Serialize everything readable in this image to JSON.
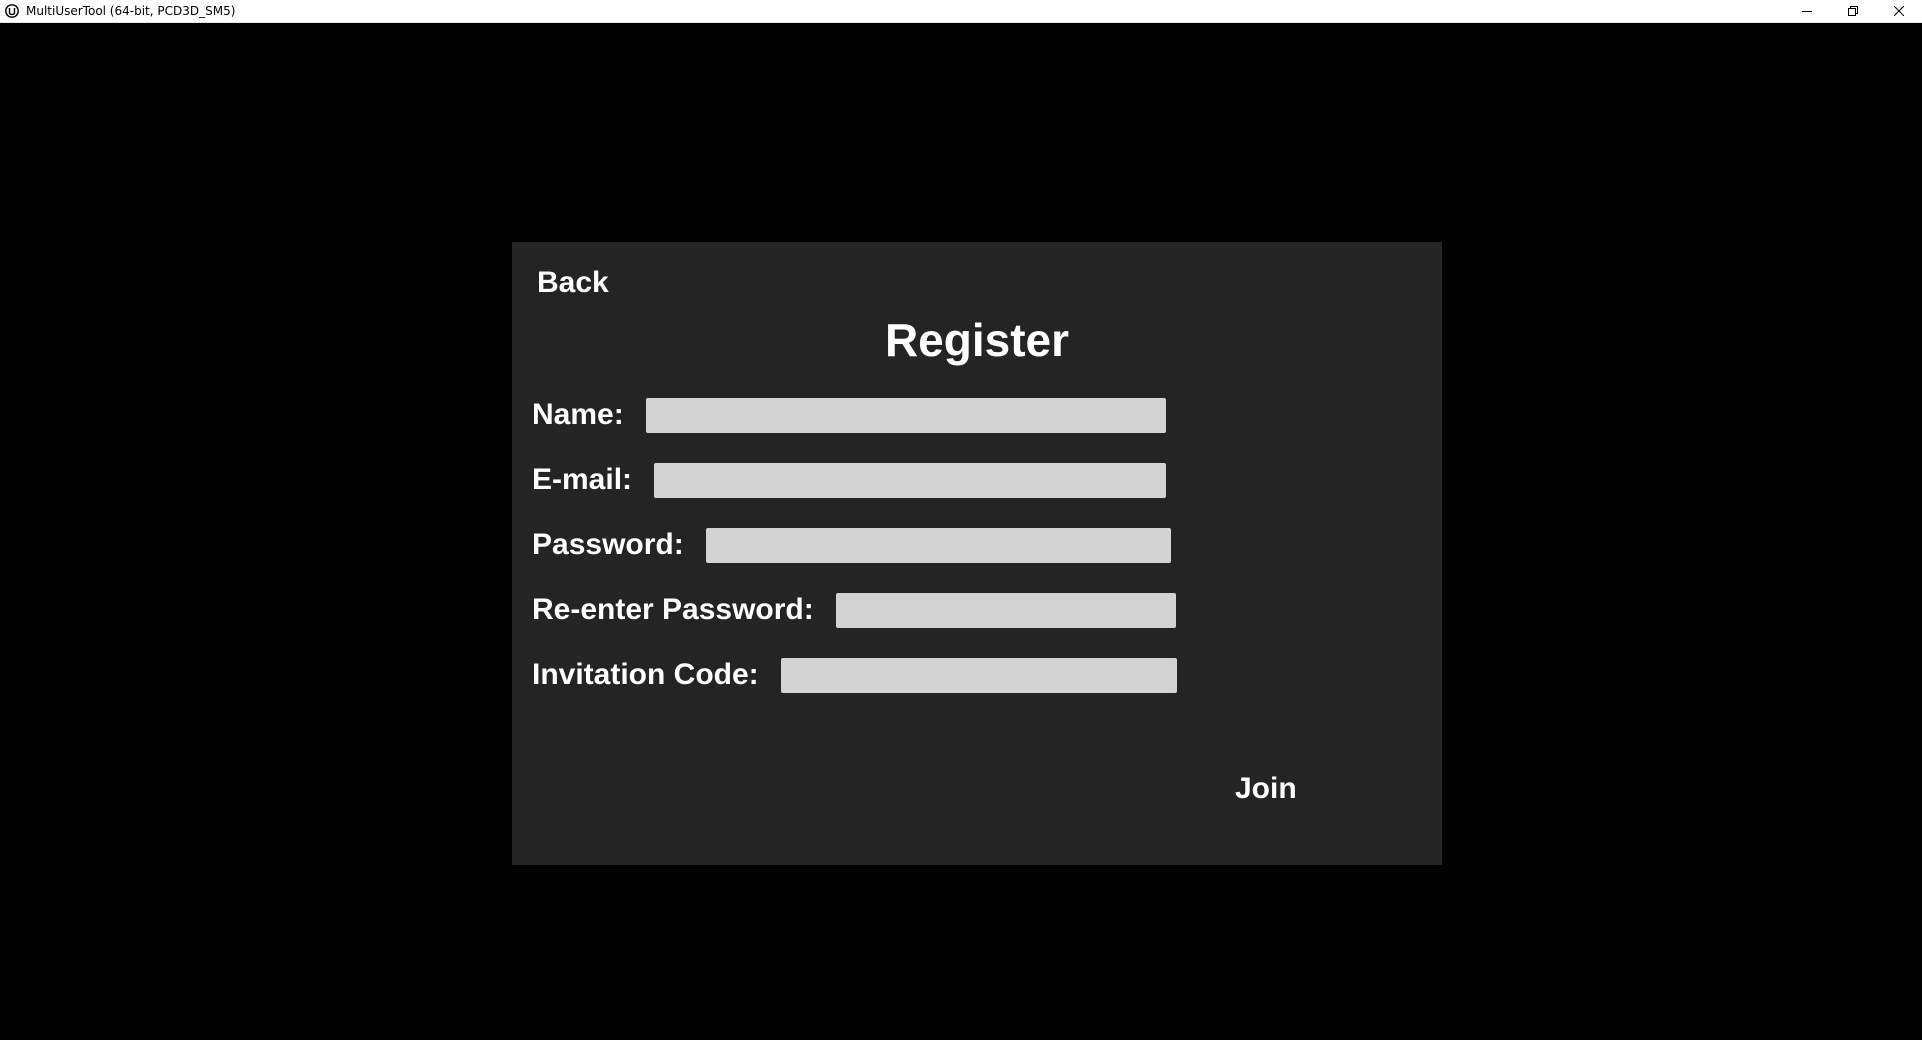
{
  "window": {
    "title": "MultiUserTool (64-bit, PCD3D_SM5)",
    "app_icon": "unreal-engine-icon",
    "controls": [
      "minimize-icon",
      "restore-icon",
      "close-icon"
    ]
  },
  "panel": {
    "back_label": "Back",
    "title": "Register",
    "fields": {
      "name": {
        "label": "Name:",
        "value": ""
      },
      "email": {
        "label": "E-mail:",
        "value": ""
      },
      "password": {
        "label": "Password:",
        "value": ""
      },
      "reenter_password": {
        "label": "Re-enter Password:",
        "value": ""
      },
      "invitation_code": {
        "label": "Invitation Code:",
        "value": ""
      }
    },
    "join_label": "Join"
  },
  "colors": {
    "background": "#000000",
    "panel": "#242424",
    "input": "#d3d3d3",
    "text": "#ffffff"
  }
}
